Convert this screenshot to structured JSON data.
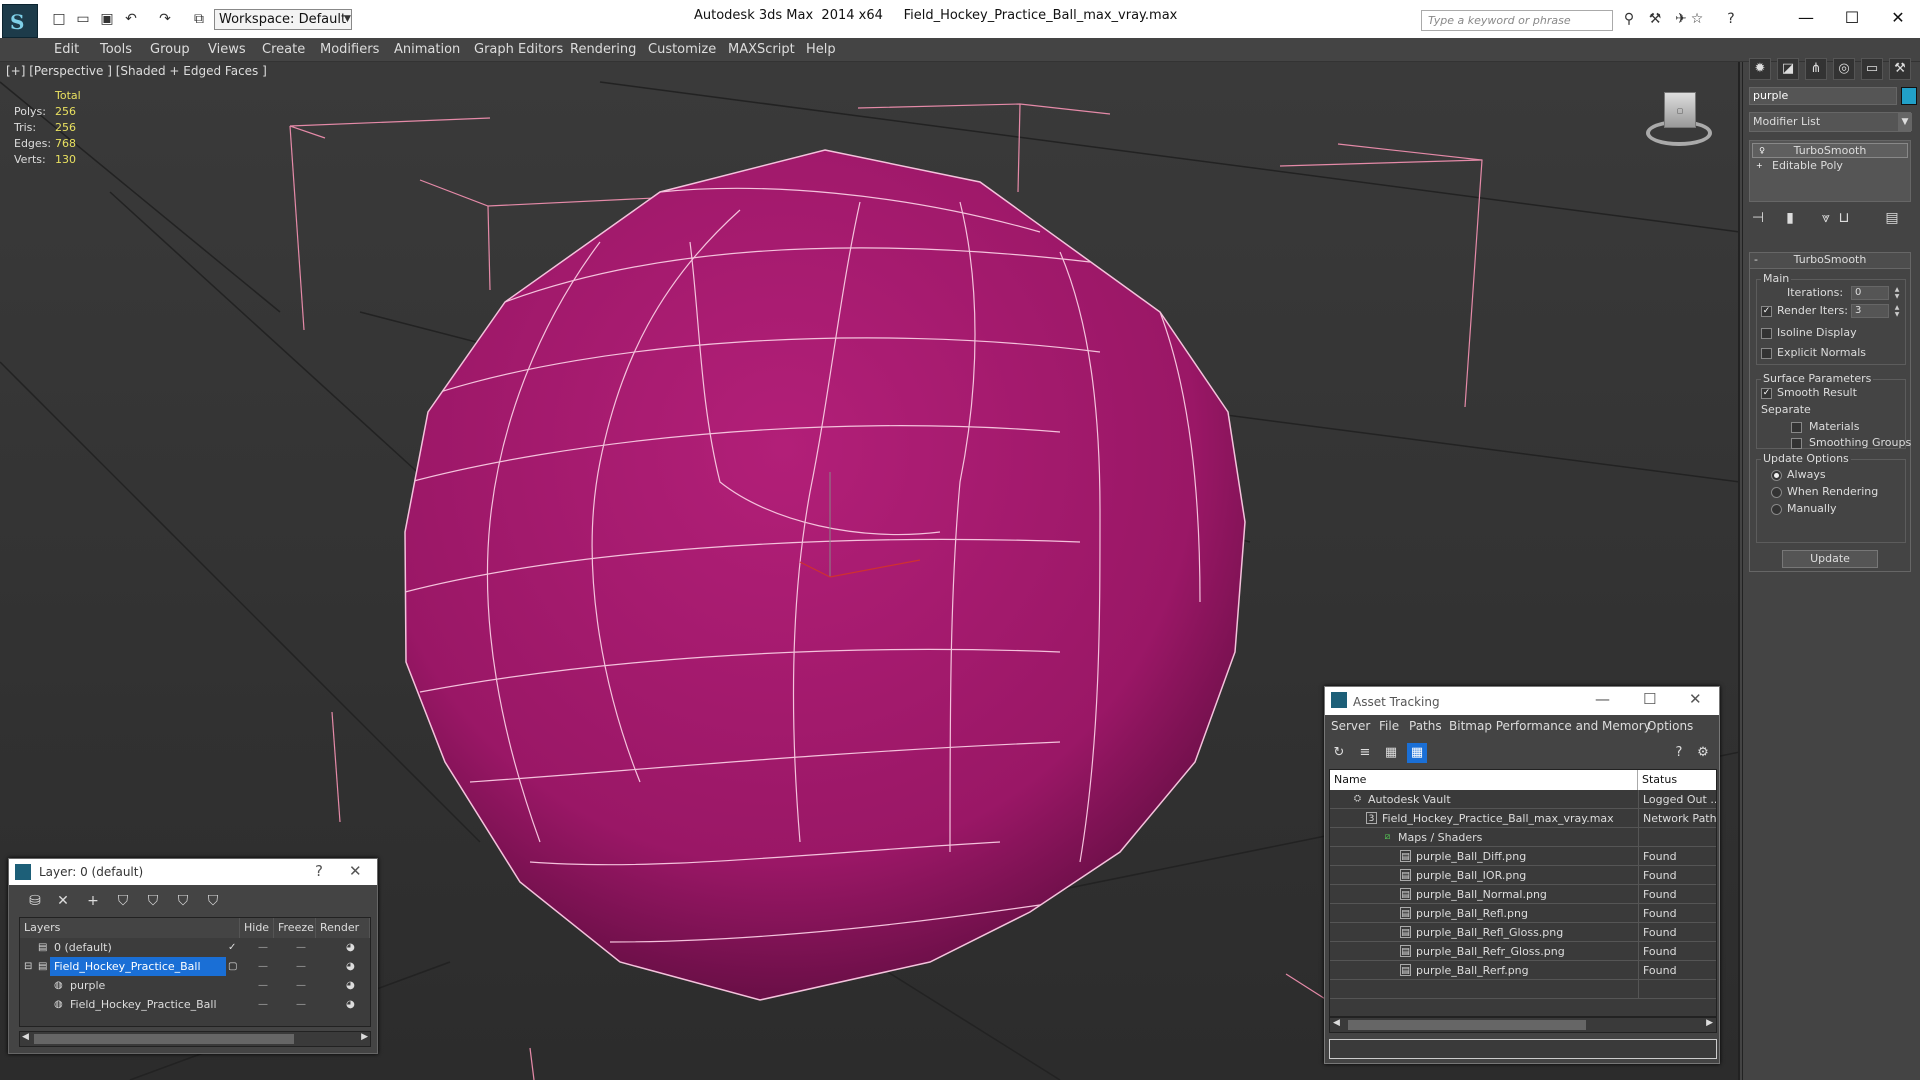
{
  "titlebar": {
    "app_title": "Autodesk 3ds Max  2014 x64",
    "file_name": "Field_Hockey_Practice_Ball_max_vray.max",
    "workspace": "Workspace: Default",
    "search_placeholder": "Type a keyword or phrase"
  },
  "menu": [
    "Edit",
    "Tools",
    "Group",
    "Views",
    "Create",
    "Modifiers",
    "Animation",
    "Graph Editors",
    "Rendering",
    "Customize",
    "MAXScript",
    "Help"
  ],
  "viewport": {
    "label": "[+] [Perspective ] [Shaded + Edged Faces ]",
    "stats": {
      "header": "Total",
      "rows": [
        {
          "label": "Polys:",
          "value": "256"
        },
        {
          "label": "Tris:",
          "value": "256"
        },
        {
          "label": "Edges:",
          "value": "768"
        },
        {
          "label": "Verts:",
          "value": "130"
        }
      ]
    },
    "object_color": "#a51a6e"
  },
  "command_panel": {
    "object_name": "purple",
    "object_color": "#21a0c8",
    "modifier_list": "Modifier List",
    "stack": [
      "TurboSmooth",
      "Editable Poly"
    ],
    "rollout_title": "TurboSmooth",
    "main_group": "Main",
    "iterations_label": "Iterations:",
    "iterations_value": "0",
    "render_iters_label": "Render Iters:",
    "render_iters_value": "3",
    "isoline_label": "Isoline Display",
    "explicit_normals_label": "Explicit Normals",
    "surface_group": "Surface Parameters",
    "smooth_result_label": "Smooth Result",
    "separate_label": "Separate",
    "materials_label": "Materials",
    "smoothing_groups_label": "Smoothing Groups",
    "update_group": "Update Options",
    "always_label": "Always",
    "when_rendering_label": "When Rendering",
    "manually_label": "Manually",
    "update_button": "Update"
  },
  "layer_dialog": {
    "title": "Layer: 0 (default)",
    "help": "?",
    "columns": [
      "Layers",
      "Hide",
      "Freeze",
      "Render"
    ],
    "rows": [
      {
        "name": "0 (default)"
      },
      {
        "name": "Field_Hockey_Practice_Ball"
      },
      {
        "name": "purple"
      },
      {
        "name": "Field_Hockey_Practice_Ball"
      }
    ]
  },
  "asset_dialog": {
    "title": "Asset Tracking",
    "menu": [
      "Server",
      "File",
      "Paths",
      "Bitmap Performance and Memory",
      "Options"
    ],
    "columns": [
      "Name",
      "Status"
    ],
    "rows": [
      {
        "name": "Autodesk Vault",
        "status": "Logged Out ..."
      },
      {
        "name": "Field_Hockey_Practice_Ball_max_vray.max",
        "status": "Network Path"
      },
      {
        "name": "Maps / Shaders",
        "status": ""
      },
      {
        "name": "purple_Ball_Diff.png",
        "status": "Found"
      },
      {
        "name": "purple_Ball_IOR.png",
        "status": "Found"
      },
      {
        "name": "purple_Ball_Normal.png",
        "status": "Found"
      },
      {
        "name": "purple_Ball_Refl.png",
        "status": "Found"
      },
      {
        "name": "purple_Ball_Refl_Gloss.png",
        "status": "Found"
      },
      {
        "name": "purple_Ball_Refr_Gloss.png",
        "status": "Found"
      },
      {
        "name": "purple_Ball_Rerf.png",
        "status": "Found"
      }
    ]
  }
}
